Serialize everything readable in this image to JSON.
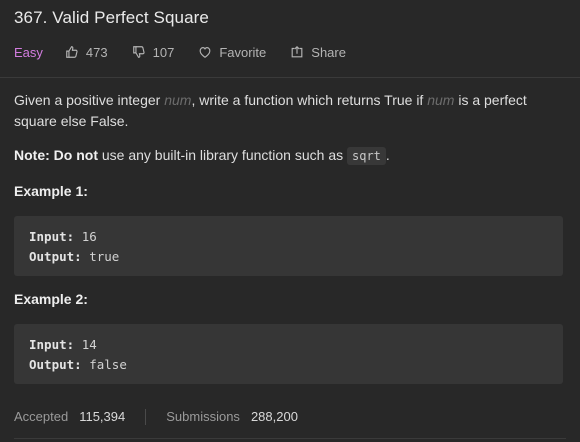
{
  "problem": {
    "title": "367. Valid Perfect Square",
    "difficulty": "Easy",
    "likes": "473",
    "dislikes": "107",
    "favorite_label": "Favorite",
    "share_label": "Share"
  },
  "description": {
    "part1": "Given a positive integer ",
    "var1": "num",
    "part2": ", write a function which returns True if ",
    "var2": "num",
    "part3": " is a perfect square else False."
  },
  "note": {
    "bold": "Note: Do not",
    "text": " use any built-in library function such as ",
    "code": "sqrt",
    "end": "."
  },
  "examples": [
    {
      "title": "Example 1:",
      "input_label": "Input:",
      "input": "16",
      "output_label": "Output:",
      "output": "true"
    },
    {
      "title": "Example 2:",
      "input_label": "Input:",
      "input": "14",
      "output_label": "Output:",
      "output": "false"
    }
  ],
  "stats": {
    "accepted_label": "Accepted",
    "accepted": "115,394",
    "submissions_label": "Submissions",
    "submissions": "288,200"
  },
  "colors": {
    "background": "#282828",
    "difficulty_easy": "#d37de0",
    "code_block": "#363636"
  },
  "icons": [
    "thumbs-up-icon",
    "thumbs-down-icon",
    "heart-icon",
    "share-icon"
  ]
}
